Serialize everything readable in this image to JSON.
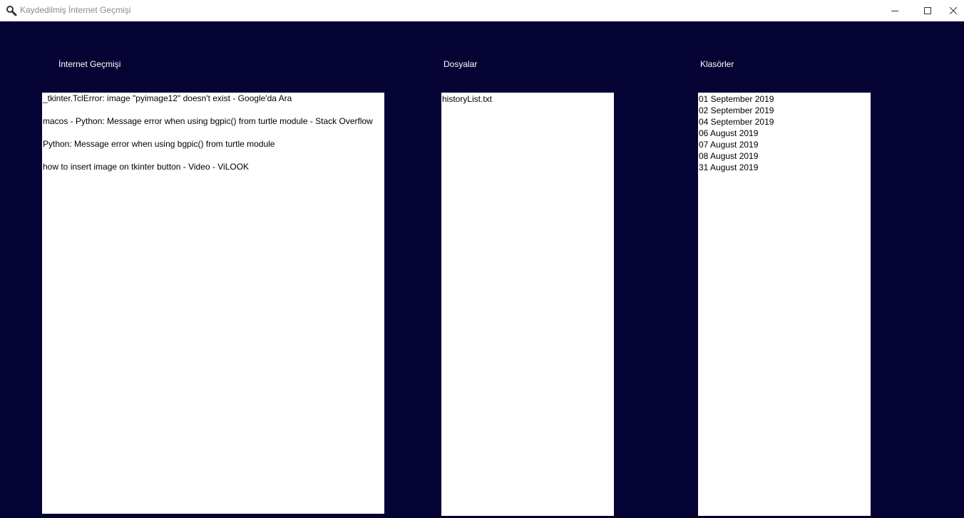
{
  "window": {
    "title": "Kaydedilmiş İnternet Geçmişi",
    "icon": "search-icon"
  },
  "colors": {
    "background": "#050333",
    "list_background": "#ffffff",
    "label_text": "#ffffff"
  },
  "columns": {
    "history": {
      "label": "İnternet Geçmişi",
      "items": [
        "_tkinter.TclError: image \"pyimage12\" doesn't exist - Google'da Ara",
        "macos - Python: Message error when using bgpic() from turtle module - Stack Overflow",
        "Python: Message error when using bgpic() from turtle module",
        "how to insert image on tkinter button - Video - ViLOOK"
      ]
    },
    "files": {
      "label": "Dosyalar",
      "items": [
        "historyList.txt"
      ]
    },
    "folders": {
      "label": "Klasörler",
      "items": [
        "01 September 2019",
        "02 September 2019",
        "04 September 2019",
        "06 August 2019",
        "07 August 2019",
        "08 August 2019",
        "31 August 2019"
      ]
    }
  }
}
